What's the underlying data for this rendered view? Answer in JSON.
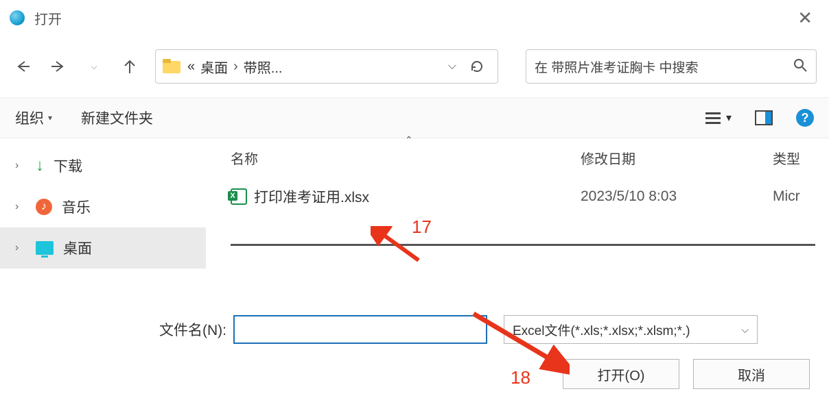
{
  "window": {
    "title": "打开"
  },
  "nav": {
    "breadcrumb_prefix": "«",
    "crumbs": [
      "桌面",
      "带照..."
    ],
    "search_placeholder": "在 带照片准考证胸卡 中搜索"
  },
  "toolbar": {
    "organize": "组织",
    "new_folder": "新建文件夹"
  },
  "sidebar": {
    "items": [
      {
        "label": "下载"
      },
      {
        "label": "音乐"
      },
      {
        "label": "桌面"
      }
    ]
  },
  "columns": {
    "name": "名称",
    "date": "修改日期",
    "type": "类型"
  },
  "files": [
    {
      "name": "打印准考证用.xlsx",
      "date": "2023/5/10 8:03",
      "type": "Micr"
    }
  ],
  "footer": {
    "filename_label": "文件名(N):",
    "filter": "Excel文件(*.xls;*.xlsx;*.xlsm;*.)",
    "open": "打开(O)",
    "cancel": "取消"
  },
  "annotations": {
    "a17": "17",
    "a18": "18"
  }
}
